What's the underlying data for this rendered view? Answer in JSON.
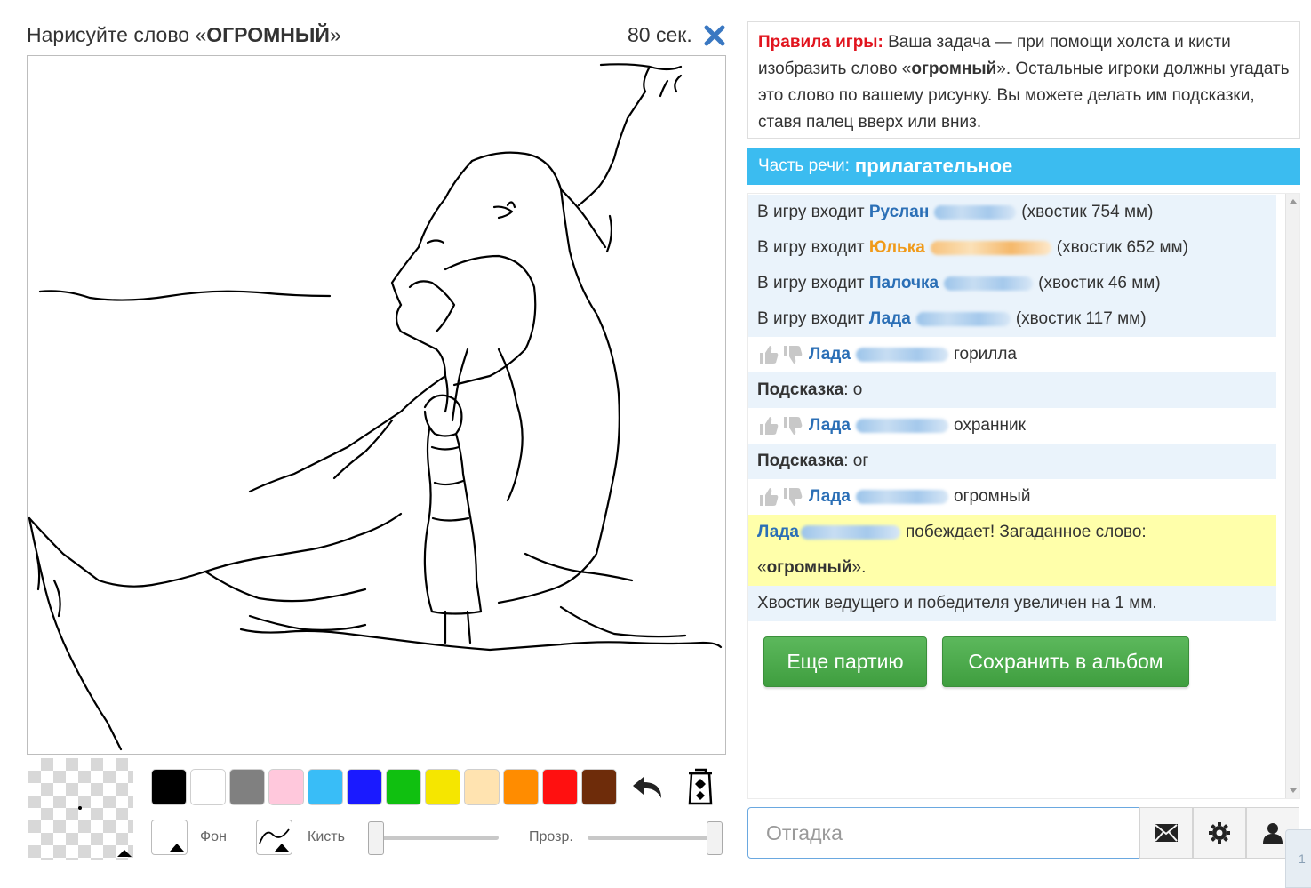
{
  "header": {
    "task_prefix": "Нарисуйте слово «",
    "task_word": "ОГРОМНЫЙ",
    "task_suffix": "»",
    "timer": "80 сек."
  },
  "palette": {
    "colors": [
      "#000000",
      "#ffffff",
      "#808080",
      "#ffc8dc",
      "#39bdf7",
      "#1a1aff",
      "#10c010",
      "#f5e600",
      "#ffe3b0",
      "#ff8c00",
      "#ff1010",
      "#6e2c0a"
    ]
  },
  "tools": {
    "background_label": "Фон",
    "brush_label": "Кисть",
    "opacity_label": "Прозр.",
    "brush_size": 0,
    "opacity": 1
  },
  "rules": {
    "title": "Правила игры:",
    "text_before": " Ваша задача — при помощи холста и кисти изобразить слово «",
    "word": "огромный",
    "text_after": "». Остальные игроки должны угадать это слово по вашему рисунку. Вы можете делать им подсказки, ставя палец вверх или вниз."
  },
  "part_of_speech": {
    "label": "Часть речи:",
    "value": "прилагательное"
  },
  "chat": {
    "join_prefix": "В игру входит",
    "joins": [
      {
        "name": "Руслан",
        "tail": "(хвостик 754 мм)"
      },
      {
        "name": "Юлька",
        "tail": "(хвостик 652 мм)"
      },
      {
        "name": "Палочка",
        "tail": "(хвостик 46 мм)"
      },
      {
        "name": "Лада",
        "tail": "(хвостик 117 мм)"
      }
    ],
    "guesses": [
      {
        "name": "Лада",
        "text": "горилла"
      },
      {
        "name": "Лада",
        "text": "охранник"
      },
      {
        "name": "Лада",
        "text": "огромный"
      }
    ],
    "hint_label": "Подсказка",
    "hints": [
      ": о",
      ": ог"
    ],
    "winner_name": "Лада",
    "winner_text": "побеждает! Загаданное слово:",
    "winner_word_open": "«",
    "winner_word": "огромный",
    "winner_word_close": "».",
    "reward": "Хвостик ведущего и победителя увеличен на 1 мм."
  },
  "buttons": {
    "again": "Еще партию",
    "save": "Сохранить в альбом"
  },
  "input": {
    "placeholder": "Отгадка",
    "value": ""
  },
  "edge_tab": "1"
}
